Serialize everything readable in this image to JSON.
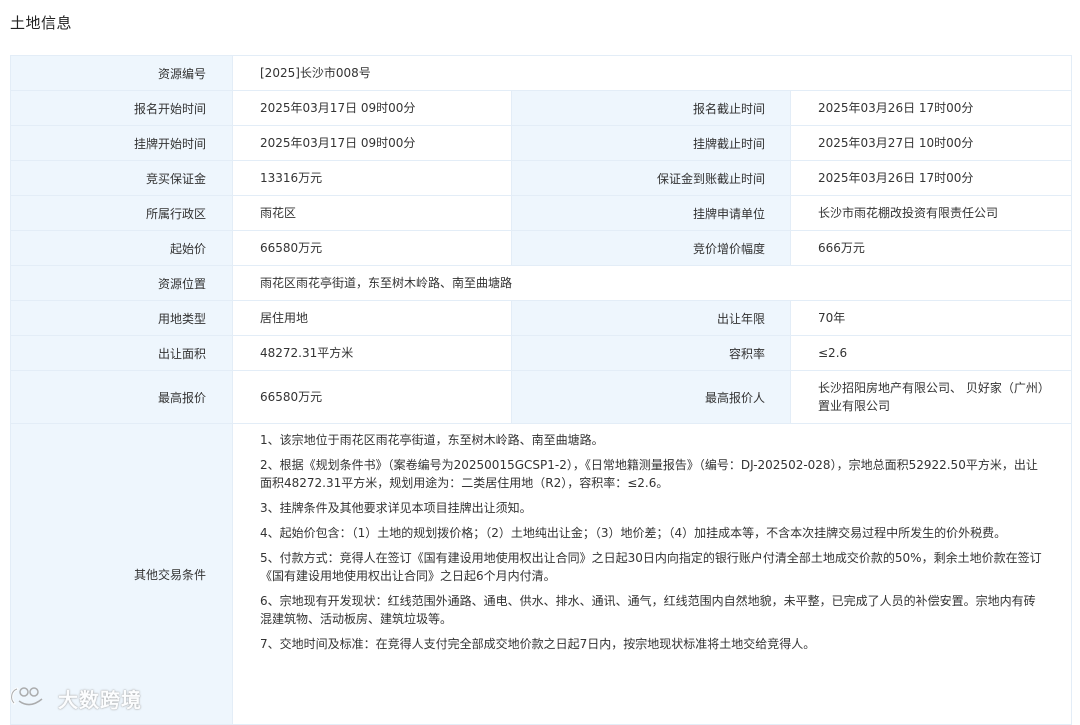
{
  "section_title": "土地信息",
  "rows": {
    "resource_no": {
      "label": "资源编号",
      "value": "[2025]长沙市008号"
    },
    "signup_start": {
      "label": "报名开始时间",
      "value": "2025年03月17日 09时00分"
    },
    "signup_end": {
      "label": "报名截止时间",
      "value": "2025年03月26日 17时00分"
    },
    "listing_start": {
      "label": "挂牌开始时间",
      "value": "2025年03月17日 09时00分"
    },
    "listing_end": {
      "label": "挂牌截止时间",
      "value": "2025年03月27日 10时00分"
    },
    "deposit": {
      "label": "竞买保证金",
      "value": "13316万元"
    },
    "deposit_deadline": {
      "label": "保证金到账截止时间",
      "value": "2025年03月26日 17时00分"
    },
    "district": {
      "label": "所属行政区",
      "value": "雨花区"
    },
    "applicant": {
      "label": "挂牌申请单位",
      "value": "长沙市雨花棚改投资有限责任公司"
    },
    "start_price": {
      "label": "起始价",
      "value": "66580万元"
    },
    "increment": {
      "label": "竞价增价幅度",
      "value": "666万元"
    },
    "location": {
      "label": "资源位置",
      "value": "雨花区雨花亭街道，东至树木岭路、南至曲塘路"
    },
    "land_use": {
      "label": "用地类型",
      "value": "居住用地"
    },
    "term": {
      "label": "出让年限",
      "value": "70年"
    },
    "area": {
      "label": "出让面积",
      "value": "48272.31平方米"
    },
    "far": {
      "label": "容积率",
      "value": "≤2.6"
    },
    "top_price": {
      "label": "最高报价",
      "value": "66580万元"
    },
    "top_bidder": {
      "label": "最高报价人",
      "value": "长沙招阳房地产有限公司、 贝好家（广州）置业有限公司"
    }
  },
  "other_terms": {
    "label": "其他交易条件",
    "items": [
      "1、该宗地位于雨花区雨花亭街道，东至树木岭路、南至曲塘路。",
      "2、根据《规划条件书》（案卷编号为20250015GCSP1-2），《日常地籍测量报告》（编号：DJ-202502-028），宗地总面积52922.50平方米，出让面积48272.31平方米，规划用途为：二类居住用地（R2），容积率：≤2.6。",
      "3、挂牌条件及其他要求详见本项目挂牌出让须知。",
      "4、起始价包含：（1）土地的规划拨价格；（2）土地纯出让金；（3）地价差；（4）加挂成本等，不含本次挂牌交易过程中所发生的价外税费。",
      "5、付款方式：竞得人在签订《国有建设用地使用权出让合同》之日起30日内向指定的银行账户付清全部土地成交价款的50%，剩余土地价款在签订《国有建设用地使用权出让合同》之日起6个月内付清。",
      "6、宗地现有开发现状：红线范围外通路、通电、供水、排水、通讯、通气，红线范围内自然地貌，未平整，已完成了人员的补偿安置。宗地内有砖混建筑物、活动板房、建筑垃圾等。",
      "7、交地时间及标准：在竞得人支付完全部成交地价款之日起7日内，按宗地现状标准将土地交给竞得人。"
    ]
  },
  "watermark": {
    "text": "大数跨境",
    "icon": "logo-icon"
  }
}
